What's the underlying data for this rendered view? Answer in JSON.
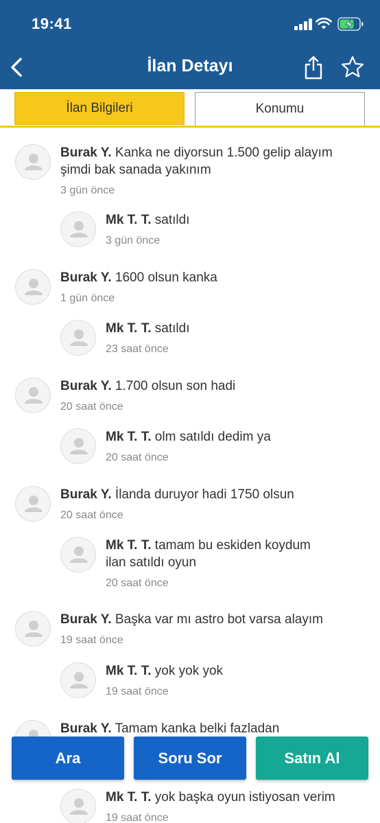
{
  "status_bar": {
    "time": "19:41"
  },
  "header": {
    "title": "İlan Detayı"
  },
  "tabs": [
    {
      "label": "İlan Bilgileri",
      "active": true
    },
    {
      "label": "Konumu",
      "active": false
    }
  ],
  "comments": [
    {
      "author": "Burak Y.",
      "text": "Kanka ne diyorsun 1.500 gelip alayım şimdi bak sanada yakınım",
      "time": "3 gün önce"
    },
    {
      "author": "Mk T. T.",
      "text": "satıldı",
      "time": "3 gün önce"
    },
    {
      "author": "Burak Y.",
      "text": "1600 olsun kanka",
      "time": "1 gün önce"
    },
    {
      "author": "Mk T. T.",
      "text": "satıldı",
      "time": "23 saat önce"
    },
    {
      "author": "Burak Y.",
      "text": "1.700 olsun son hadi",
      "time": "20 saat önce"
    },
    {
      "author": "Mk T. T.",
      "text": "olm satıldı dedim ya",
      "time": "20 saat önce"
    },
    {
      "author": "Burak Y.",
      "text": "İlanda duruyor hadi 1750 olsun",
      "time": "20 saat önce"
    },
    {
      "author": "Mk T. T.",
      "text": "tamam bu eskiden koydum ilan satıldı oyun",
      "time": "20 saat önce"
    },
    {
      "author": "Burak Y.",
      "text": "Başka var mı astro bot varsa alayım",
      "time": "19 saat önce"
    },
    {
      "author": "Mk T. T.",
      "text": "yok yok yok",
      "time": "19 saat önce"
    },
    {
      "author": "Burak Y.",
      "text": "Tamam kanka belki fazladan",
      "time": ""
    },
    {
      "author": "Mk T. T.",
      "text": "yok başka oyun istiyosan verim",
      "time": "19 saat önce"
    }
  ],
  "actions": {
    "call_label": "Ara",
    "ask_label": "Soru Sor",
    "buy_label": "Satın Al"
  },
  "colors": {
    "header_bg": "#1d5a94",
    "tab_accent": "#f7c71c",
    "primary_button": "#1565c8",
    "buy_button": "#14a895"
  }
}
